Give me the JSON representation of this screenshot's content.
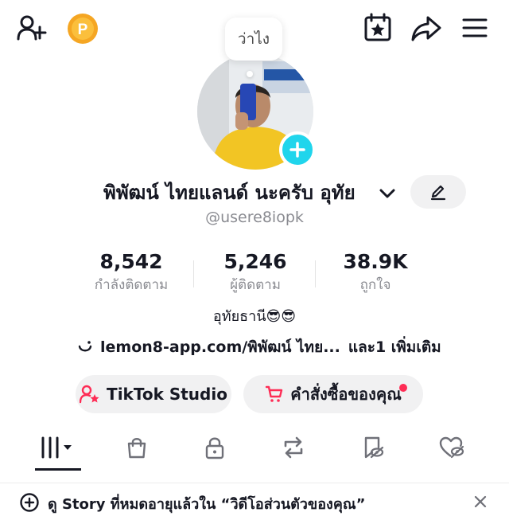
{
  "status_bubble": "ว่าไง",
  "profile": {
    "display_name": "พิพัฒน์ ไทยแลนด์ นะครับ อุทัย",
    "username": "@usere8iopk"
  },
  "stats": [
    {
      "value": "8,542",
      "label": "กำลังติดตาม"
    },
    {
      "value": "5,246",
      "label": "ผู้ติดตาม"
    },
    {
      "value": "38.9K",
      "label": "ถูกใจ"
    }
  ],
  "bio": "อุทัยธานี😎😎",
  "link": {
    "text": "lemon8-app.com/พิพัฒน์ ไทย...",
    "extra": "และ1 เพิ่มเติม"
  },
  "actions": {
    "studio_label": "TikTok Studio",
    "orders_label": "คำสั่งซื้อของคุณ"
  },
  "story_banner": {
    "text": "ดู Story ที่หมดอายุแล้วใน “วิดีโอส่วนตัวของคุณ”"
  },
  "colors": {
    "accent_cyan": "#20d5ec",
    "notification_red": "#fe2c55",
    "coin_orange": "#f5a623",
    "pill_bg": "#f1f1f2",
    "secondary_text": "#8a8b91"
  },
  "icons": {
    "top_left": [
      "add-user-icon",
      "coin-icon"
    ],
    "top_right": [
      "calendar-star-icon",
      "share-icon",
      "menu-icon"
    ],
    "tabs": [
      "videos-grid-icon",
      "shop-bag-icon",
      "lock-icon",
      "repost-icon",
      "favorites-icon",
      "liked-heart-icon"
    ]
  }
}
